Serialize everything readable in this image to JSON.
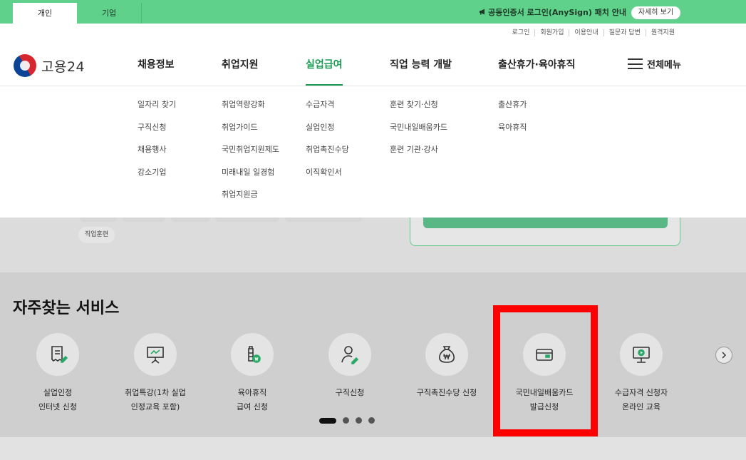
{
  "topbar": {
    "tab_personal": "개인",
    "tab_corporate": "기업",
    "notice": "공동인증서 로그인(AnySign) 패치 안내",
    "notice_icon": "megaphone-icon",
    "detail_button": "자세히 보기"
  },
  "utility": [
    "로그인",
    "회원가입",
    "이용안내",
    "질문과 답변",
    "원격지원"
  ],
  "logo": {
    "text": "고용24"
  },
  "gnb": {
    "menus": [
      "채용정보",
      "취업지원",
      "실업급여",
      "직업 능력 개발",
      "출산휴가·육아휴직"
    ],
    "active": "실업급여",
    "all_menu": "전체메뉴"
  },
  "submenus": [
    [
      "일자리 찾기",
      "구직신청",
      "채용행사",
      "강소기업"
    ],
    [
      "취업역량강화",
      "취업가이드",
      "국민취업지원제도",
      "미래내일 일경험",
      "취업지원금"
    ],
    [
      "수급자격",
      "실업인정",
      "취업촉진수당",
      "이직확인서"
    ],
    [
      "훈련 찾기·신청",
      "국민내일배움카드",
      "훈련 기관·강사"
    ],
    [
      "출산휴가",
      "육아휴직"
    ]
  ],
  "hero": {
    "tag": "직업훈련"
  },
  "service": {
    "title": "자주찾는 서비스",
    "items": [
      {
        "label": "실업인정\n인터넷 신청",
        "icon": "document-edit-icon"
      },
      {
        "label": "취업특강(1차 실업\n인정교육 포함)",
        "icon": "presentation-board-icon"
      },
      {
        "label": "육아휴직\n급여 신청",
        "icon": "baby-bottle-won-icon"
      },
      {
        "label": "구직신청",
        "icon": "person-edit-icon"
      },
      {
        "label": "구직촉진수당 신청",
        "icon": "money-bag-won-icon"
      },
      {
        "label": "국민내일배움카드\n발급신청",
        "icon": "card-icon"
      },
      {
        "label": "수급자격 신청자\n온라인 교육",
        "icon": "monitor-play-icon"
      }
    ],
    "next_icon": "chevron-right-icon",
    "pagination": {
      "pages": 4,
      "current": 1
    }
  },
  "colors": {
    "brand_green": "#5fd18b",
    "active_green": "#1a9a54",
    "highlight": "#ff0000"
  }
}
